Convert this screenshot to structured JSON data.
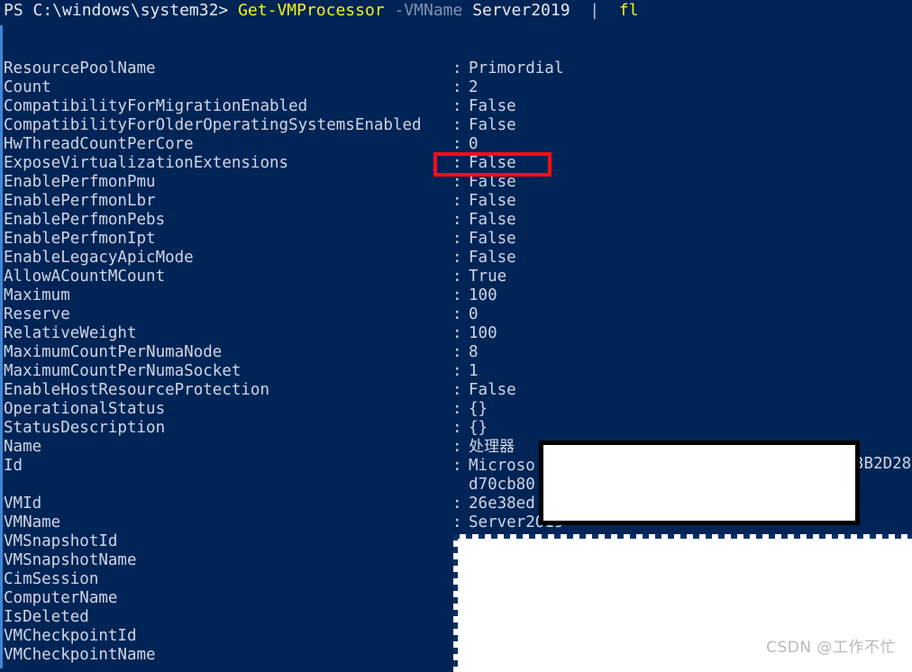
{
  "console": {
    "background_color": "#012456",
    "foreground_color": "#cfd6e4",
    "accent_yellow": "#f2f21c",
    "annotation_red": "#f50f11"
  },
  "prompt": {
    "prefix": "PS C:\\windows\\system32> ",
    "command": "Get-VMProcessor",
    "space1": " ",
    "parameter": "-VMName",
    "space2": " ",
    "argument": "Server2019",
    "pipe": "  |  ",
    "format": "fl"
  },
  "properties": [
    {
      "name": "ResourcePoolName",
      "colon": ":",
      "value": "Primordial"
    },
    {
      "name": "Count",
      "colon": ":",
      "value": "2"
    },
    {
      "name": "CompatibilityForMigrationEnabled",
      "colon": ":",
      "value": "False"
    },
    {
      "name": "CompatibilityForOlderOperatingSystemsEnabled",
      "colon": ":",
      "value": "False"
    },
    {
      "name": "HwThreadCountPerCore",
      "colon": ":",
      "value": "0"
    },
    {
      "name": "ExposeVirtualizationExtensions",
      "colon": ":",
      "value": "False"
    },
    {
      "name": "EnablePerfmonPmu",
      "colon": ":",
      "value": "False"
    },
    {
      "name": "EnablePerfmonLbr",
      "colon": ":",
      "value": "False"
    },
    {
      "name": "EnablePerfmonPebs",
      "colon": ":",
      "value": "False"
    },
    {
      "name": "EnablePerfmonIpt",
      "colon": ":",
      "value": "False"
    },
    {
      "name": "EnableLegacyApicMode",
      "colon": ":",
      "value": "False"
    },
    {
      "name": "AllowACountMCount",
      "colon": ":",
      "value": "True"
    },
    {
      "name": "Maximum",
      "colon": ":",
      "value": "100"
    },
    {
      "name": "Reserve",
      "colon": ":",
      "value": "0"
    },
    {
      "name": "RelativeWeight",
      "colon": ":",
      "value": "100"
    },
    {
      "name": "MaximumCountPerNumaNode",
      "colon": ":",
      "value": "8"
    },
    {
      "name": "MaximumCountPerNumaSocket",
      "colon": ":",
      "value": "1"
    },
    {
      "name": "EnableHostResourceProtection",
      "colon": ":",
      "value": "False"
    },
    {
      "name": "OperationalStatus",
      "colon": ":",
      "value": "{}"
    },
    {
      "name": "StatusDescription",
      "colon": ":",
      "value": "{}"
    },
    {
      "name": "Name",
      "colon": ":",
      "value": "处理器"
    },
    {
      "name": "Id",
      "colon": ":",
      "value": "Microso"
    },
    {
      "name": "",
      "colon": "",
      "value": "d70cb80"
    },
    {
      "name": "VMId",
      "colon": ":",
      "value": "26e38ed"
    },
    {
      "name": "VMName",
      "colon": ":",
      "value": "Server2019"
    },
    {
      "name": "VMSnapshotId",
      "colon": ":",
      "value": ""
    },
    {
      "name": "VMSnapshotName",
      "colon": ":",
      "value": ""
    },
    {
      "name": "CimSession",
      "colon": ":",
      "value": ""
    },
    {
      "name": "ComputerName",
      "colon": ":",
      "value": ""
    },
    {
      "name": "IsDeleted",
      "colon": ":",
      "value": ""
    },
    {
      "name": "VMCheckpointId",
      "colon": ":",
      "value": ""
    },
    {
      "name": "VMCheckpointName",
      "colon": ":",
      "value": ""
    }
  ],
  "id_tail_fragment": "3B2D28",
  "watermark": "CSDN @工作不忙"
}
